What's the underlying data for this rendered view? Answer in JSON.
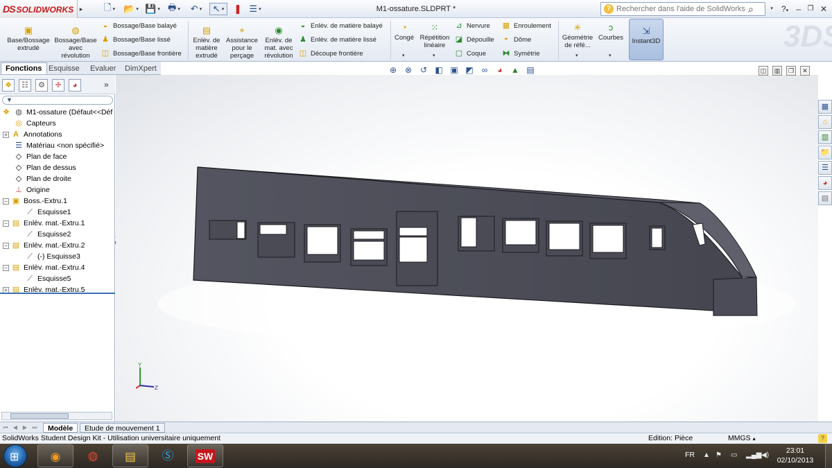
{
  "app": {
    "logo": "SOLIDWORKS",
    "logo_prefix": "DS",
    "window_title": "M1-ossature.SLDPRT *"
  },
  "search": {
    "placeholder": "Rechercher dans l'aide de SolidWorks"
  },
  "ribbon": {
    "groups": {
      "base_extrude": "Base/Bossage extrudé",
      "base_revolve": "Bossage/Base avec révolution",
      "swept_boss": "Bossage/Base balayé",
      "loft_boss": "Bossage/Base lissé",
      "boundary_boss": "Bossage/Base frontière",
      "extruded_cut": "Enlèv. de matière extrudé",
      "hole_wizard": "Assistance pour le perçage",
      "revolved_cut": "Enlèv. de mat. avec révolution",
      "swept_cut": "Enlèv. de matière balayé",
      "lofted_cut": "Enlèv. de matière lissé",
      "boundary_cut": "Découpe frontière",
      "fillet": "Congé",
      "linear_pattern": "Répétition linéaire",
      "rib": "Nervure",
      "draft": "Dépouille",
      "shell": "Coque",
      "wrap": "Enroulement",
      "dome": "Dôme",
      "mirror": "Symétrie",
      "ref_geometry": "Géométrie de réfé...",
      "curves": "Courbes",
      "instant3d": "Instant3D"
    },
    "watermark": "3DS"
  },
  "panel_tabs": [
    "Fonctions",
    "Esquisse",
    "Evaluer",
    "DimXpert"
  ],
  "tree": {
    "root": "M1-ossature  (Défaut<<Déf",
    "items": [
      {
        "label": "Capteurs",
        "icon": "sensor-icon"
      },
      {
        "label": "Annotations",
        "icon": "annotation-icon"
      },
      {
        "label": "Matériau <non spécifié>",
        "icon": "material-icon"
      },
      {
        "label": "Plan de face",
        "icon": "plane-icon"
      },
      {
        "label": "Plan de dessus",
        "icon": "plane-icon"
      },
      {
        "label": "Plan de droite",
        "icon": "plane-icon"
      },
      {
        "label": "Origine",
        "icon": "origin-icon"
      },
      {
        "label": "Boss.-Extru.1",
        "icon": "boss-extrude-icon"
      },
      {
        "label": "Esquisse1",
        "icon": "sketch-icon"
      },
      {
        "label": "Enlèv. mat.-Extru.1",
        "icon": "cut-extrude-icon"
      },
      {
        "label": "Esquisse2",
        "icon": "sketch-icon"
      },
      {
        "label": "Enlèv. mat.-Extru.2",
        "icon": "cut-extrude-icon"
      },
      {
        "label": "(-) Esquisse3",
        "icon": "sketch-icon"
      },
      {
        "label": "Enlèv. mat.-Extru.4",
        "icon": "cut-extrude-icon"
      },
      {
        "label": "Esquisse5",
        "icon": "sketch-icon"
      },
      {
        "label": "Enlèv. mat.-Extru.5",
        "icon": "cut-extrude-icon"
      }
    ]
  },
  "triad": {
    "y": "Y",
    "z": "Z"
  },
  "bottom_tabs": [
    "Modèle",
    "Etude de mouvement 1"
  ],
  "status": {
    "message": "SolidWorks Student Design Kit - Utilisation universitaire uniquement",
    "edit_mode": "Edition: Pièce",
    "units": "MMGS"
  },
  "taskbar": {
    "lang": "FR",
    "time": "23:01",
    "date": "02/10/2013",
    "apps": [
      "firefox-icon",
      "chrome-icon",
      "explorer-icon",
      "skype-icon",
      "solidworks-icon"
    ]
  },
  "colors": {
    "model_face": "#4a4b55",
    "model_edge": "#1b1b1f",
    "window_white": "#ffffff",
    "accent": "#3a6fb5"
  }
}
